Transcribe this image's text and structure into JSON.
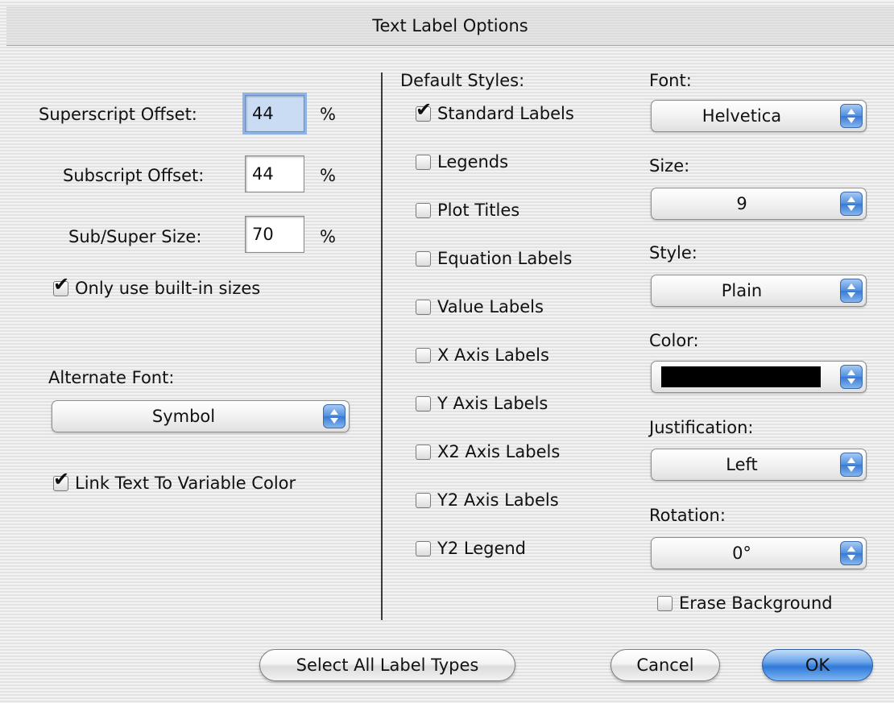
{
  "window": {
    "title": "Text Label Options"
  },
  "left": {
    "superscript_offset_label": "Superscript Offset:",
    "superscript_offset_value": "44",
    "subscript_offset_label": "Subscript Offset:",
    "subscript_offset_value": "44",
    "sub_super_size_label": "Sub/Super Size:",
    "sub_super_size_value": "70",
    "percent": "%",
    "only_builtin_sizes": {
      "label": "Only use built-in sizes",
      "checked": true
    },
    "alternate_font_label": "Alternate Font:",
    "alternate_font_value": "Symbol",
    "link_text_color": {
      "label": "Link Text To Variable Color",
      "checked": true
    }
  },
  "default_styles": {
    "header": "Default Styles:",
    "items": [
      {
        "label": "Standard Labels",
        "checked": true
      },
      {
        "label": "Legends",
        "checked": false
      },
      {
        "label": "Plot Titles",
        "checked": false
      },
      {
        "label": "Equation Labels",
        "checked": false
      },
      {
        "label": "Value Labels",
        "checked": false
      },
      {
        "label": "X Axis Labels",
        "checked": false
      },
      {
        "label": "Y Axis Labels",
        "checked": false
      },
      {
        "label": "X2 Axis Labels",
        "checked": false
      },
      {
        "label": "Y2 Axis Labels",
        "checked": false
      },
      {
        "label": "Y2 Legend",
        "checked": false
      }
    ]
  },
  "style_options": {
    "font_label": "Font:",
    "font_value": "Helvetica",
    "size_label": "Size:",
    "size_value": "9",
    "style_label": "Style:",
    "style_value": "Plain",
    "color_label": "Color:",
    "color_value": "#000000",
    "justification_label": "Justification:",
    "justification_value": "Left",
    "rotation_label": "Rotation:",
    "rotation_value": "0°",
    "erase_background": {
      "label": "Erase Background",
      "checked": false
    }
  },
  "buttons": {
    "select_all": "Select All Label Types",
    "cancel": "Cancel",
    "ok": "OK"
  },
  "colors": {
    "focus_ring": "#8fb3e6",
    "default_button": "#2f79d8"
  }
}
